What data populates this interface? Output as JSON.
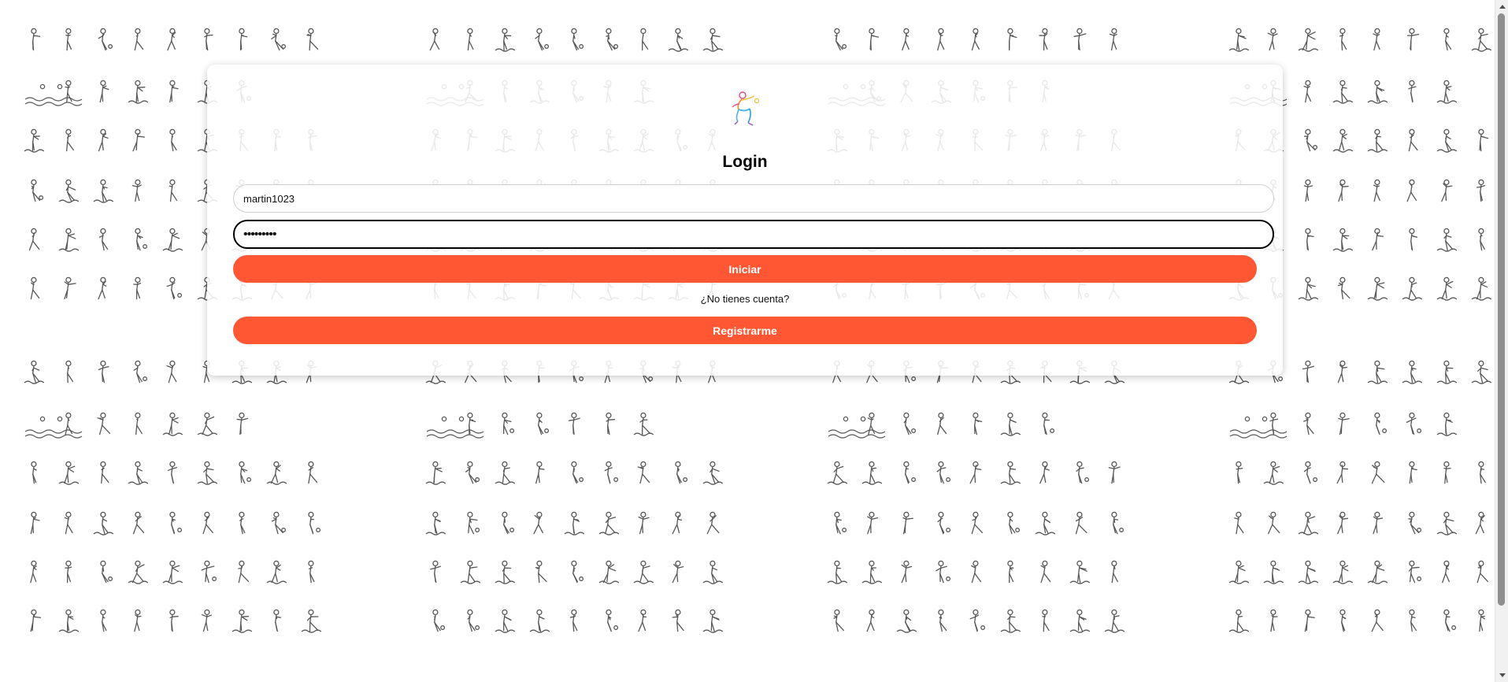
{
  "login": {
    "title": "Login",
    "username_value": "martin1023",
    "password_value": "•••••••••",
    "login_button": "Iniciar",
    "no_account_text": "¿No tienes cuenta?",
    "register_button": "Registrarme"
  },
  "background": {
    "pattern_icon": "sports-pictogram-pattern",
    "icon_color": "#3a3a3a"
  },
  "colors": {
    "accent": "#ff5733",
    "page_background": "#ffffff",
    "card_background": "#ffffff"
  },
  "icons": {
    "logo": "athlete-logo-icon",
    "scroll_up": "arrow-up-icon",
    "scroll_down": "arrow-down-icon"
  }
}
